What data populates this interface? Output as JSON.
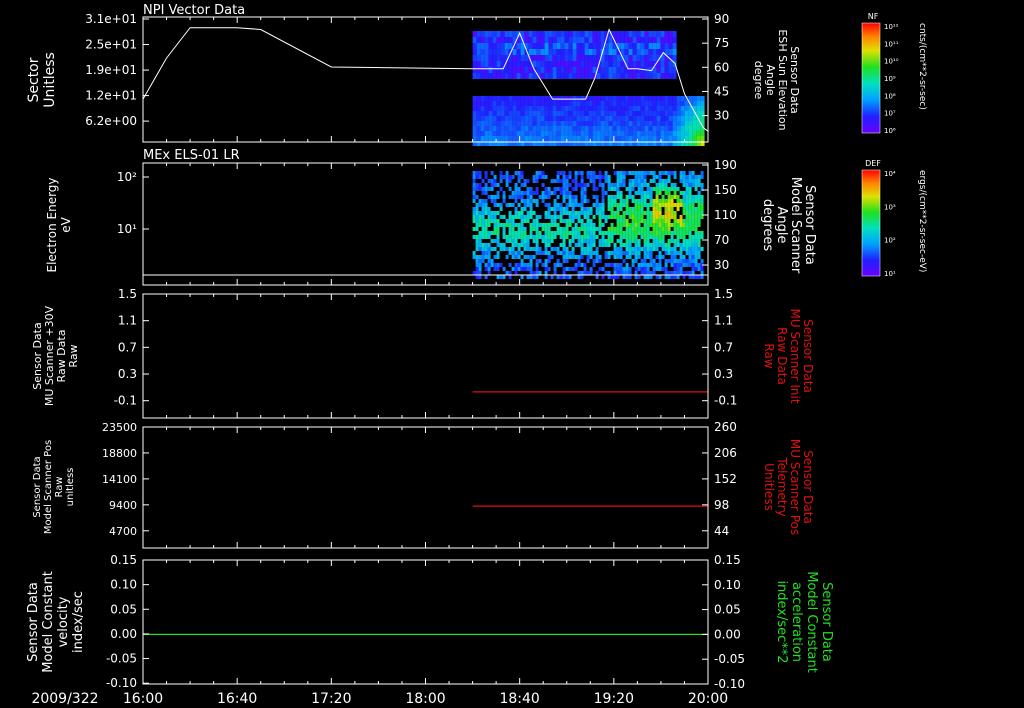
{
  "colors": {
    "background": "#000000",
    "axis": "#ffffff",
    "red_series": "#e01010",
    "green_series": "#20e020",
    "white_series": "#ffffff"
  },
  "x_axis": {
    "date_label": "2009/322",
    "tick_labels": [
      "16:00",
      "16:40",
      "17:20",
      "18:00",
      "18:40",
      "19:20",
      "20:00"
    ],
    "start": "16:00",
    "end": "20:00"
  },
  "chart_data": [
    {
      "type": "heatmap",
      "title": "NPI Vector Data",
      "ylabel_lines": [
        "Sector",
        "Unitless"
      ],
      "y_tick_labels": [
        "3.1e+01",
        "2.5e+01",
        "1.9e+01",
        "1.2e+01",
        "6.2e+00"
      ],
      "right_label_lines": [
        "Sensor Data",
        "ESH Sun Elevation",
        "Angle",
        "degree"
      ],
      "right_tick_labels": [
        "90",
        "75",
        "60",
        "45",
        "30"
      ],
      "right_ylim": [
        20,
        90
      ],
      "data_window": [
        "18:20",
        "19:58"
      ],
      "colorbar": {
        "title": "NF",
        "unit": "cnts/(cm**2-sr-sec)",
        "labels": [
          "10¹²",
          "10¹¹",
          "10¹⁰",
          "10⁹",
          "10⁸",
          "10⁷",
          "10⁶"
        ]
      },
      "line_overlay": {
        "name": "ESH Sun Elevation Angle",
        "x": [
          "16:00",
          "16:10",
          "16:20",
          "16:40",
          "16:50",
          "17:20",
          "18:20",
          "18:33",
          "18:40",
          "18:46",
          "18:54",
          "19:08",
          "19:12",
          "19:18",
          "19:26",
          "19:30",
          "19:36",
          "19:41",
          "19:46",
          "19:50",
          "19:58",
          "20:00"
        ],
        "values": [
          44,
          67,
          84,
          84,
          83,
          62,
          61,
          61,
          81,
          61,
          44,
          44,
          56,
          83,
          61,
          61,
          60,
          70,
          64,
          47,
          28,
          26
        ]
      }
    },
    {
      "type": "heatmap",
      "title": "MEx ELS-01 LR",
      "ylabel_lines": [
        "Electron Energy",
        "eV"
      ],
      "y_tick_labels": [
        "10²",
        "10¹"
      ],
      "y_scale": "log",
      "right_label_lines": [
        "Sensor Data",
        "Model Scanner",
        "Angle",
        "degrees"
      ],
      "right_tick_labels": [
        "190",
        "150",
        "110",
        "70",
        "30"
      ],
      "right_ylim": [
        0,
        190
      ],
      "data_window": [
        "18:20",
        "19:58"
      ],
      "colorbar": {
        "title": "DEF",
        "unit": "ergs/(cm**2-sr-sec-eV)",
        "labels": [
          "10⁴",
          "10³",
          "10²",
          "10¹"
        ]
      },
      "line_overlay": {
        "name": "Model Scanner Angle",
        "x": [
          "16:00",
          "20:00"
        ],
        "values": [
          0,
          0
        ]
      }
    },
    {
      "type": "line",
      "ylabel_lines": [
        "Sensor Data",
        "MU Scanner +30V",
        "Raw Data",
        "Raw"
      ],
      "y_tick_labels": [
        "1.5",
        "1.1",
        "0.7",
        "0.3",
        "-0.1"
      ],
      "ylim": [
        -0.4,
        1.5
      ],
      "right_label_lines": [
        "Sensor Data",
        "MU Scanner Init",
        "Raw Data",
        "Raw"
      ],
      "right_tick_labels": [
        "1.5",
        "1.1",
        "0.7",
        "0.3",
        "-0.1"
      ],
      "right_ylim": [
        -0.4,
        1.5
      ],
      "series": [
        {
          "axis": "right",
          "color": "#e01010",
          "x": [
            "18:20",
            "20:00"
          ],
          "values": [
            0,
            0
          ]
        }
      ]
    },
    {
      "type": "line",
      "ylabel_lines": [
        "Sensor Data",
        "Model Scanner Pos",
        "Raw",
        "unitless"
      ],
      "y_tick_labels": [
        "23500",
        "18800",
        "14100",
        "9400",
        "4700"
      ],
      "ylim": [
        0,
        23500
      ],
      "right_label_lines": [
        "Sensor Data",
        "MU Scanner Pos",
        "Telemetry",
        "Unitless"
      ],
      "right_tick_labels": [
        "260",
        "206",
        "152",
        "98",
        "44"
      ],
      "right_ylim": [
        0,
        260
      ],
      "series": [
        {
          "axis": "right",
          "color": "#e01010",
          "x": [
            "18:20",
            "20:00"
          ],
          "values": [
            90,
            90
          ]
        }
      ]
    },
    {
      "type": "line",
      "ylabel_lines": [
        "Sensor Data",
        "Model Constant",
        "velocity",
        "index/sec"
      ],
      "y_tick_labels": [
        "0.15",
        "0.10",
        "0.05",
        "0.00",
        "-0.05",
        "-0.10"
      ],
      "ylim": [
        -0.1,
        0.15
      ],
      "right_label_lines": [
        "Sensor Data",
        "Model Constant",
        "acceleration",
        "index/sec**2"
      ],
      "right_tick_labels": [
        "0.15",
        "0.10",
        "0.05",
        "0.00",
        "-0.05",
        "-0.10"
      ],
      "right_ylim": [
        -0.1,
        0.15
      ],
      "series": [
        {
          "axis": "left",
          "color": "#20e020",
          "x": [
            "16:00",
            "20:00"
          ],
          "values": [
            0,
            0
          ]
        }
      ]
    }
  ]
}
